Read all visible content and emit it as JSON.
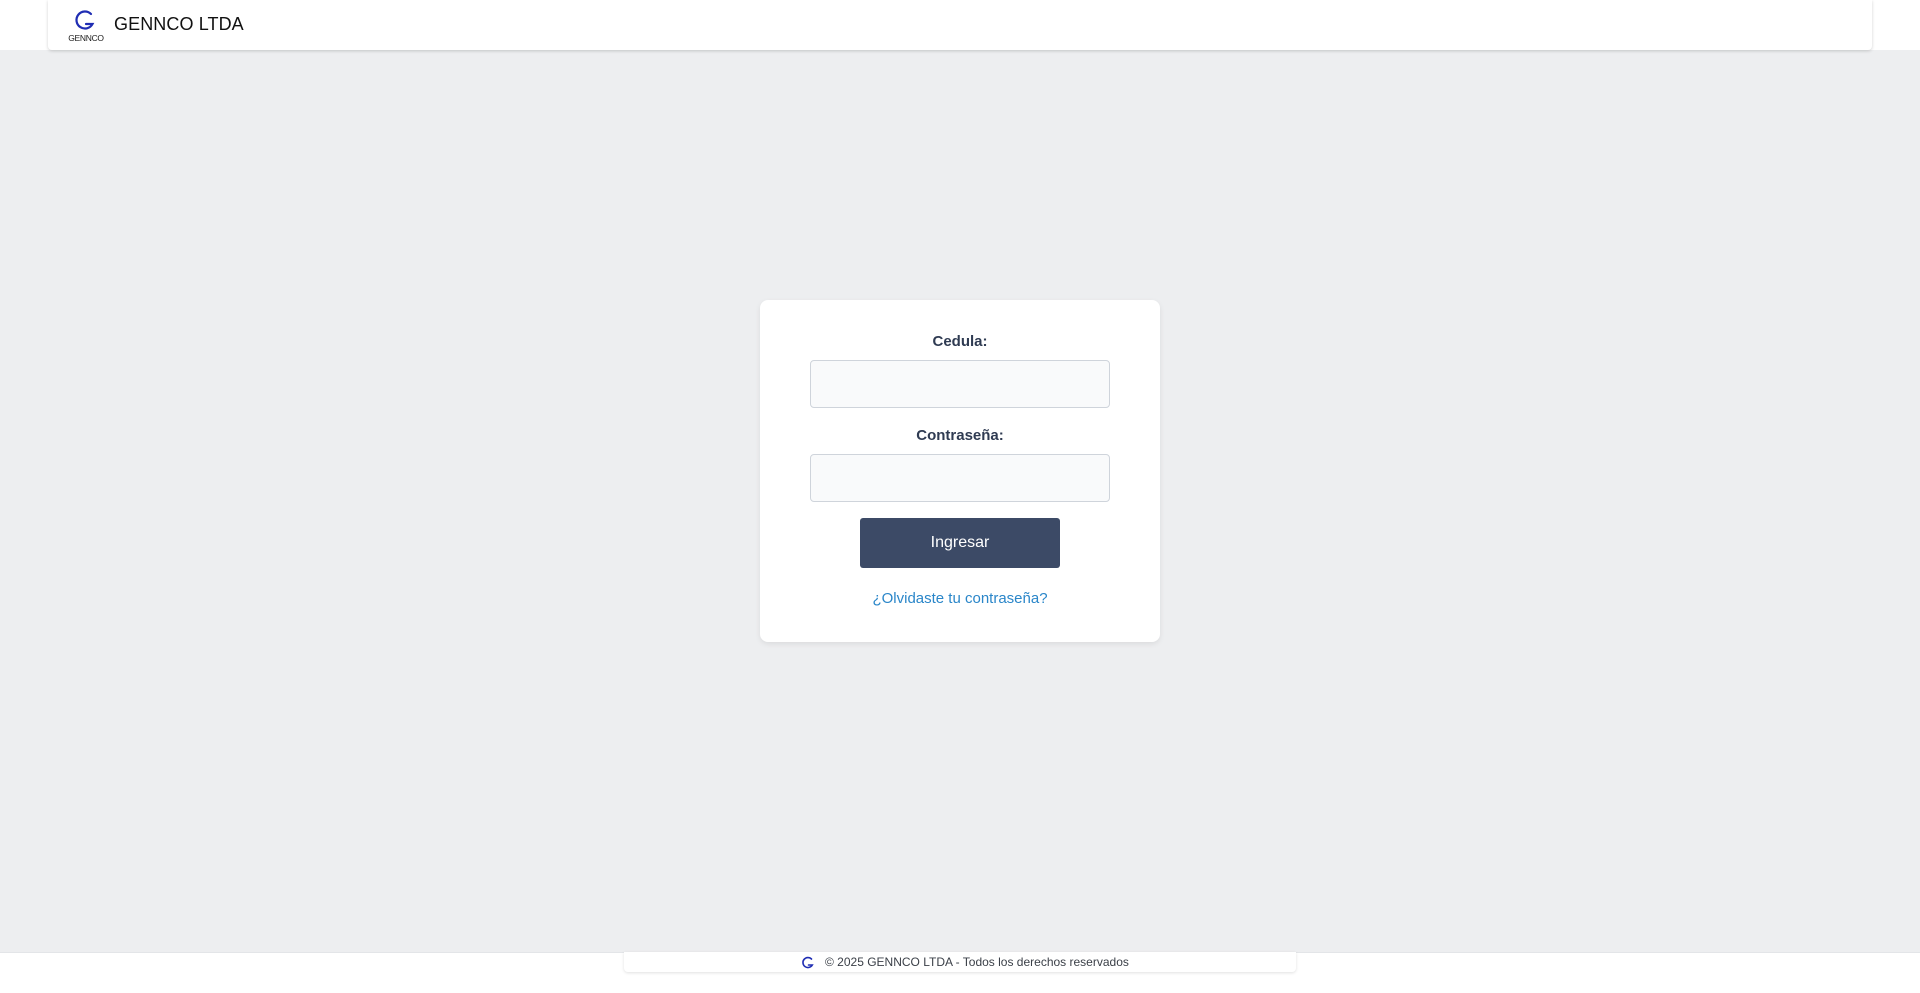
{
  "header": {
    "logo_text": "GENNCO",
    "brand": "GENNCO LTDA"
  },
  "login": {
    "cedula_label": "Cedula:",
    "cedula_value": "",
    "password_label": "Contraseña:",
    "password_value": "",
    "submit_label": "Ingresar",
    "forgot_label": "¿Olvidaste tu contraseña?"
  },
  "footer": {
    "text": "© 2025 GENNCO LTDA - Todos los derechos reservados"
  },
  "colors": {
    "background": "#edeef0",
    "button": "#3c4a66",
    "link": "#2a86c9",
    "label": "#2f3b52",
    "logo_blue": "#1f2db3"
  }
}
